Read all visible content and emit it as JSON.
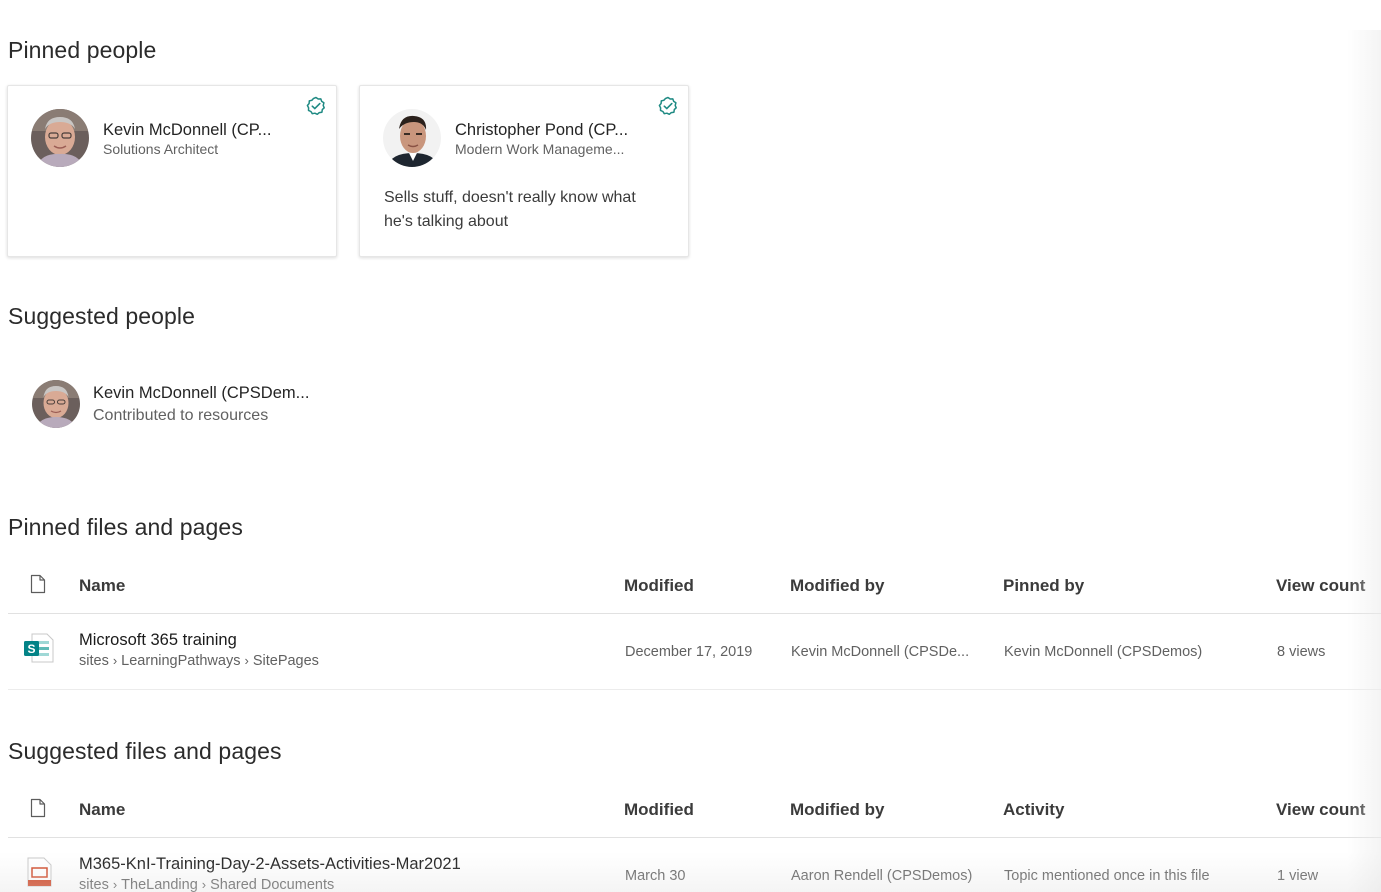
{
  "pinned_people": {
    "title": "Pinned people",
    "cards": [
      {
        "name": "Kevin McDonnell (CP...",
        "job_title": "Solutions Architect",
        "note": "",
        "badge_icon": "verified-check-icon"
      },
      {
        "name": "Christopher Pond (CP...",
        "job_title": "Modern Work Manageme...",
        "note": "Sells stuff, doesn't really know what he's talking about",
        "badge_icon": "verified-check-icon"
      }
    ]
  },
  "suggested_people": {
    "title": "Suggested people",
    "items": [
      {
        "name": "Kevin McDonnell (CPSDem...",
        "description": "Contributed to resources"
      }
    ]
  },
  "pinned_files": {
    "title": "Pinned files and pages",
    "columns": {
      "icon": "document-icon",
      "name": "Name",
      "modified": "Modified",
      "modified_by": "Modified by",
      "extra": "Pinned by",
      "view_count": "View count"
    },
    "rows": [
      {
        "icon": "sharepoint-page-icon",
        "name": "Microsoft 365 training",
        "path": [
          "sites",
          "LearningPathways",
          "SitePages"
        ],
        "modified": "December 17, 2019",
        "modified_by": "Kevin McDonnell (CPSDe...",
        "extra": "Kevin McDonnell (CPSDemos)",
        "view_count": "8 views"
      }
    ]
  },
  "suggested_files": {
    "title": "Suggested files and pages",
    "columns": {
      "icon": "document-icon",
      "name": "Name",
      "modified": "Modified",
      "modified_by": "Modified by",
      "extra": "Activity",
      "view_count": "View count"
    },
    "rows": [
      {
        "icon": "powerpoint-file-icon",
        "name": "M365-KnI-Training-Day-2-Assets-Activities-Mar2021",
        "path": [
          "sites",
          "TheLanding",
          "Shared Documents"
        ],
        "modified": "March 30",
        "modified_by": "Aaron Rendell (CPSDemos)",
        "extra": "Topic mentioned once in this file",
        "view_count": "1 view"
      }
    ]
  },
  "colors": {
    "badge": "#1f8a83",
    "sharepoint": "#038387",
    "powerpoint": "#d04423"
  }
}
